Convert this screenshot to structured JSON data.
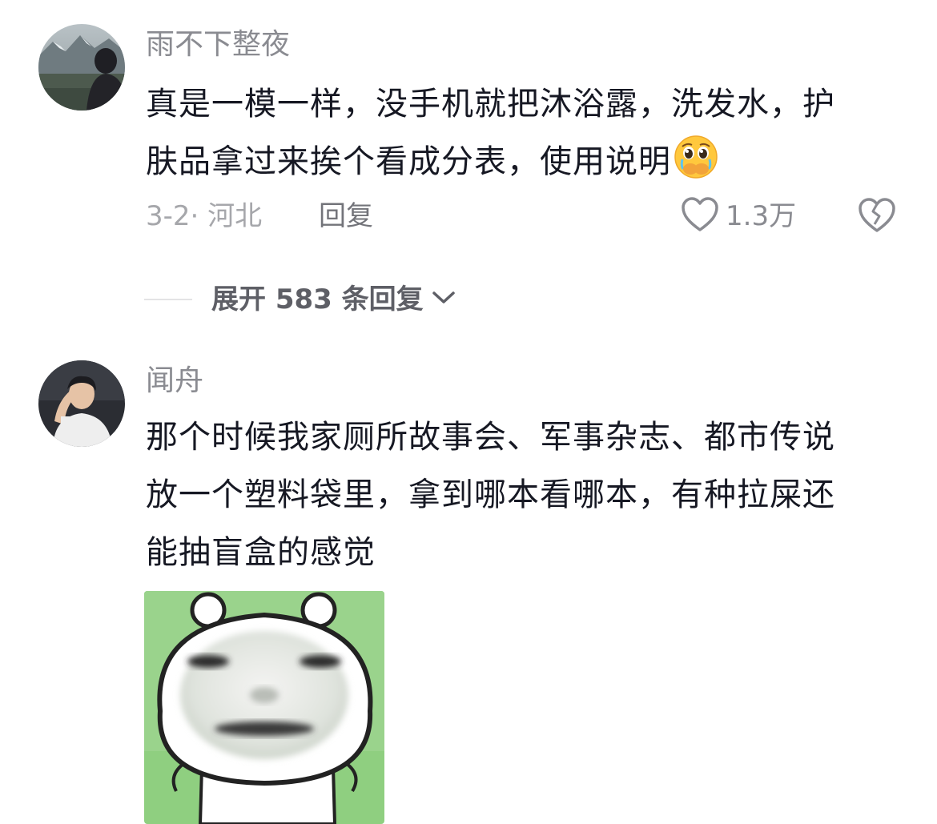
{
  "comments": [
    {
      "username": "雨不下整夜",
      "content_lines": [
        "真是一模一样，没手机就把沐浴露，洗发水，护",
        "肤品拿过来挨个看成分表，使用说明"
      ],
      "emoji": "pleading-face-covering-mouth-emoji",
      "date": "3-2",
      "location": "河北",
      "meta_text": "3-2· 河北",
      "reply_label": "回复",
      "like_count": "1.3万",
      "expand_label": "展开 583 条回复"
    },
    {
      "username": "闻舟",
      "content_lines": [
        "那个时候我家厕所故事会、军事杂志、都市传说",
        "放一个塑料袋里，拿到哪本看哪本，有种拉屎还",
        "能抽盲盒的感觉"
      ],
      "sticker": "blurry-face-bear-sticker"
    }
  ],
  "icons": {
    "like": "heart-outline-icon",
    "dislike": "broken-heart-icon",
    "expand": "chevron-down-icon"
  },
  "colors": {
    "text_primary": "#161823",
    "text_secondary": "#8a8b91",
    "text_tertiary": "#a6a7ab",
    "sticker_bg": "#8fcf80"
  }
}
